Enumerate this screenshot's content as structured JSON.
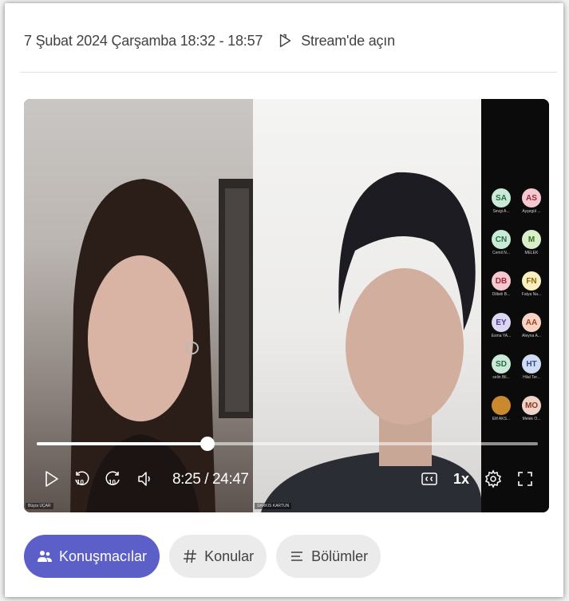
{
  "header": {
    "meeting_time": "7 Şubat 2024 Çarşamba 18:32 - 18:57",
    "open_in_stream": "Stream'de açın"
  },
  "video": {
    "left_participant": "Büşra UÇAR",
    "right_participant": "SARKIS KARTUN",
    "roster": [
      {
        "initials": "SA",
        "name": "Sevgi A...",
        "bg": "#c9ead6",
        "fg": "#2a6b45"
      },
      {
        "initials": "AS",
        "name": "Ayşegül ...",
        "bg": "#f5c9cf",
        "fg": "#9e2a38"
      },
      {
        "initials": "CN",
        "name": "Cemil N...",
        "bg": "#c9ead6",
        "fg": "#2a6b45"
      },
      {
        "initials": "M",
        "name": "MELEK",
        "bg": "#d9efc9",
        "fg": "#3c6b21"
      },
      {
        "initials": "DB",
        "name": "Dilbeli B...",
        "bg": "#f5c9cf",
        "fg": "#9e2a38"
      },
      {
        "initials": "FN",
        "name": "Fatya Na...",
        "bg": "#fbeec0",
        "fg": "#8a6a0a"
      },
      {
        "initials": "EY",
        "name": "Esma YA...",
        "bg": "#dcd6f2",
        "fg": "#4b3d8f"
      },
      {
        "initials": "AA",
        "name": "Aleyna A...",
        "bg": "#f6d3c4",
        "fg": "#a3431c"
      },
      {
        "initials": "SD",
        "name": "selin Bil...",
        "bg": "#c9ead6",
        "fg": "#2a6b45"
      },
      {
        "initials": "HT",
        "name": "Hilal Ter...",
        "bg": "#d0dcf3",
        "fg": "#2f4c8f"
      },
      {
        "initials": "",
        "name": "Elif AKS...",
        "bg": "#c98a2f",
        "fg": "#ffffff"
      },
      {
        "initials": "MO",
        "name": "Melek O...",
        "bg": "#f0d3c8",
        "fg": "#8a3a1c"
      }
    ],
    "progress_fraction": 0.34,
    "time": "8:25 / 24:47",
    "speed": "1x",
    "skip_seconds": "10"
  },
  "tabs": [
    {
      "label": "Konuşmacılar",
      "active": true
    },
    {
      "label": "Konular",
      "active": false
    },
    {
      "label": "Bölümler",
      "active": false
    }
  ],
  "colors": {
    "accent": "#5b5fc7",
    "tab_bg": "#ebebeb"
  }
}
